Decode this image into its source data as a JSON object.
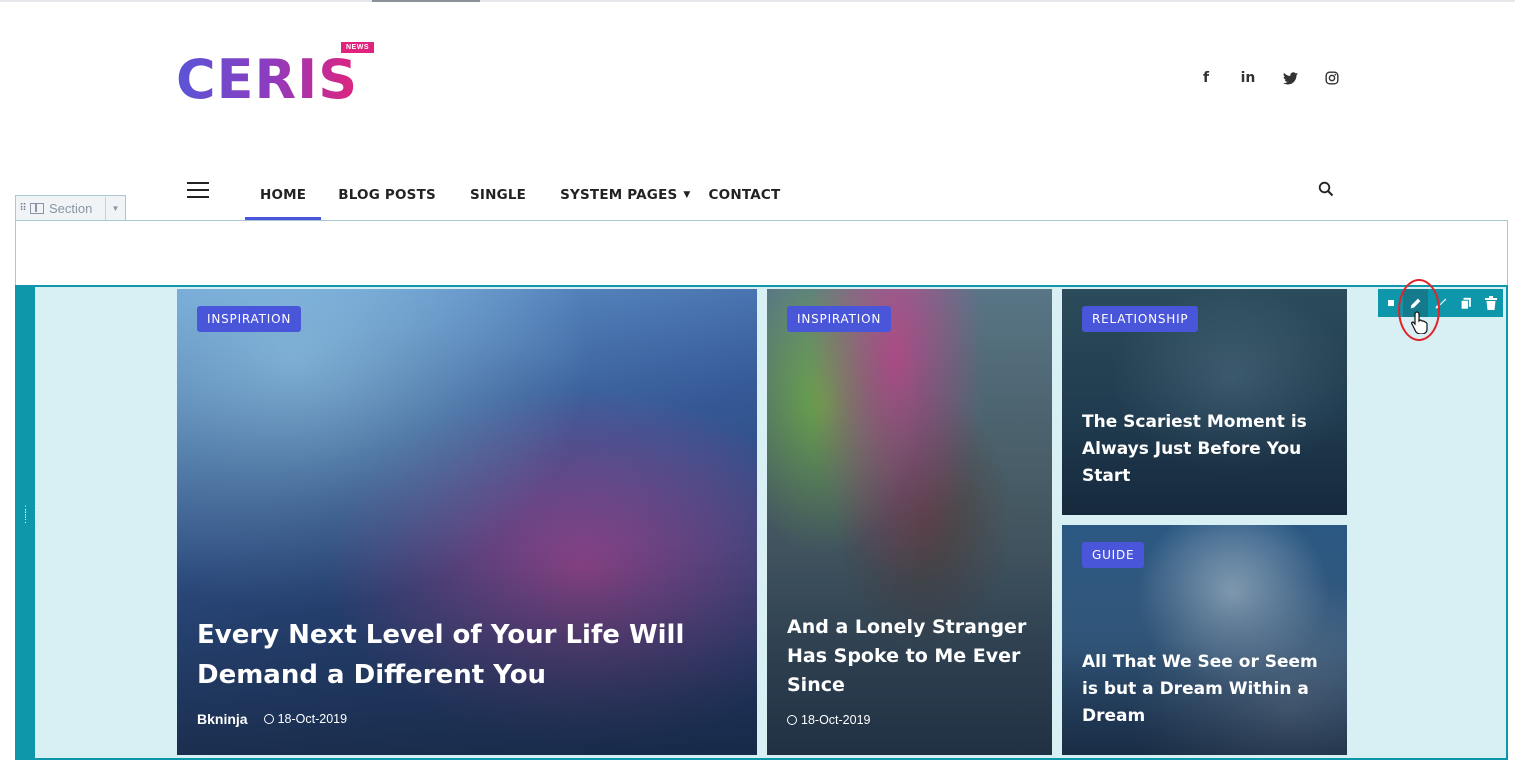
{
  "brand": {
    "logo_text": "CERIS",
    "logo_badge": "NEWS"
  },
  "social": [
    {
      "icon": "facebook-icon",
      "glyph": "f"
    },
    {
      "icon": "linkedin-icon",
      "glyph": "in"
    },
    {
      "icon": "twitter-icon",
      "glyph": "t"
    },
    {
      "icon": "instagram-icon",
      "glyph": "◎"
    }
  ],
  "nav": {
    "items": [
      "HOME",
      "BLOG POSTS",
      "SINGLE",
      "SYSTEM PAGES",
      "CONTACT"
    ],
    "active": "HOME",
    "dropdown_caret": "▼"
  },
  "editor": {
    "section_label": "Section"
  },
  "colors": {
    "accent": "#4a56d9",
    "editor_teal": "#0e97ab",
    "highlight_red": "#e0242a"
  },
  "cards": [
    {
      "category": "INSPIRATION",
      "title": "Every Next Level of Your Life Will Demand a Different You",
      "author": "Bkninja",
      "date": "18-Oct-2019"
    },
    {
      "category": "INSPIRATION",
      "title": "And a Lonely Stranger Has Spoke to Me Ever Since",
      "date": "18-Oct-2019"
    },
    {
      "category": "RELATIONSHIP",
      "title": "The Scariest Moment is Always Just Before You Start"
    },
    {
      "category": "GUIDE",
      "title": "All That We See or Seem is but a Dream Within a Dream"
    }
  ]
}
